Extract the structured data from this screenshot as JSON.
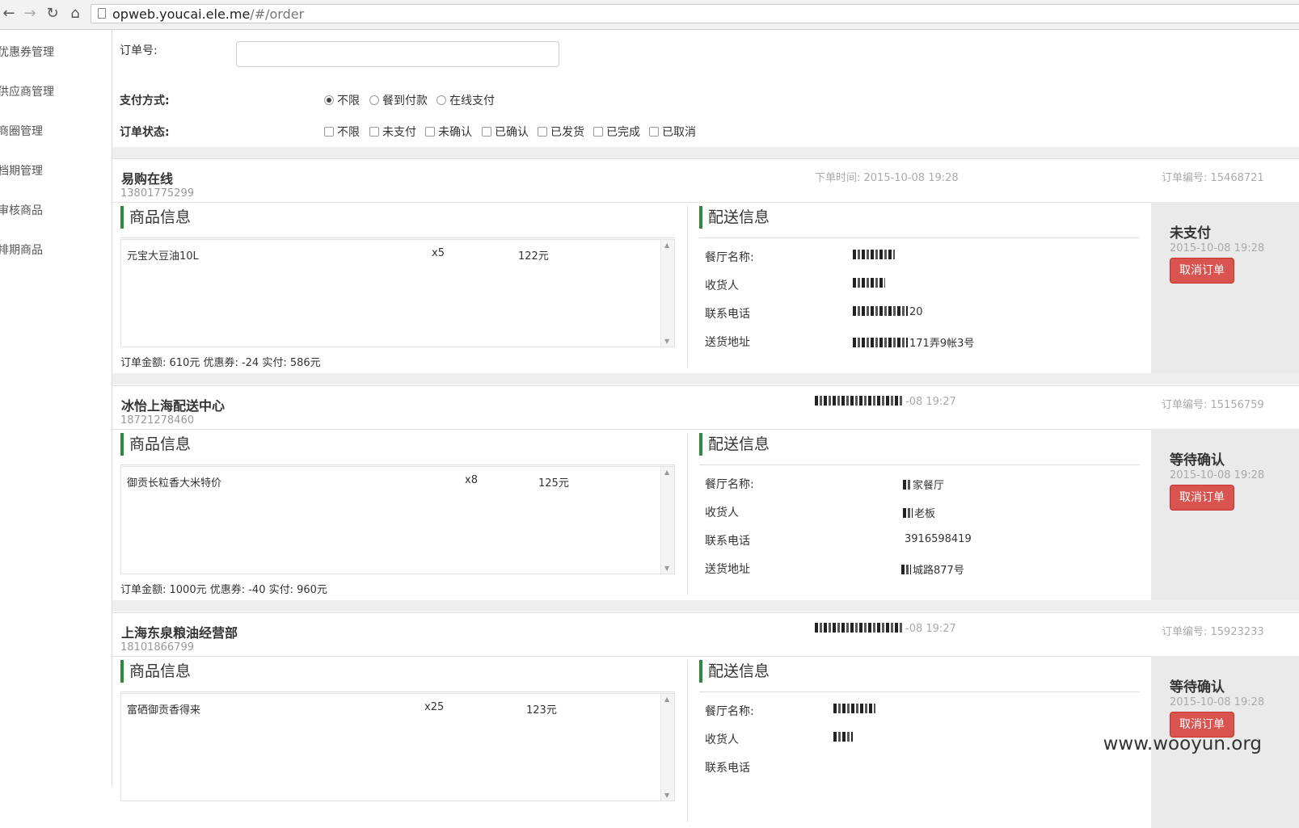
{
  "browser": {
    "url_host": "opweb.youcai.ele.me",
    "url_path": "/#/order"
  },
  "sidebar": {
    "items": [
      "优惠券管理",
      "供应商管理",
      "商圈管理",
      "档期管理",
      "审核商品",
      "排期商品"
    ]
  },
  "filters": {
    "order_no_label": "订单号:",
    "order_no_value": "",
    "payment_label": "支付方式:",
    "payment_options": [
      "不限",
      "餐到付款",
      "在线支付"
    ],
    "payment_selected": "不限",
    "status_label": "订单状态:",
    "status_options": [
      "不限",
      "未支付",
      "未确认",
      "已确认",
      "已发货",
      "已完成",
      "已取消"
    ]
  },
  "labels": {
    "goods_title": "商品信息",
    "delivery_title": "配送信息",
    "restaurant": "餐厅名称:",
    "receiver": "收货人",
    "contact": "联系电话",
    "address": "送货地址",
    "cancel": "取消订单"
  },
  "orders": [
    {
      "shop": "易购在线",
      "phone": "13801775299",
      "order_time": "下单时间: 2015-10-08 19:28",
      "order_no": "订单编号: 15468721",
      "item_name": "元宝大豆油10L",
      "item_qty": "x5",
      "item_price": "122元",
      "summary": "订单金额: 610元 优惠券: -24 实付: 586元",
      "restaurant_value": "",
      "receiver_value": "",
      "contact_value": "20",
      "address_value": "171弄9帐3号",
      "status": "未支付",
      "status_time": "2015-10-08 19:28"
    },
    {
      "shop": "冰怡上海配送中心",
      "phone": "18721278460",
      "order_time": "-08 19:27",
      "order_no": "订单编号: 15156759",
      "item_name": "御贡长粒香大米特价",
      "item_qty": "x8",
      "item_price": "125元",
      "summary": "订单金额: 1000元 优惠券: -40 实付: 960元",
      "restaurant_value": "家餐厅",
      "receiver_value": "老板",
      "contact_value": "3916598419",
      "address_value": "城路877号",
      "status": "等待确认",
      "status_time": "2015-10-08 19:28"
    },
    {
      "shop": "上海东泉粮油经营部",
      "phone": "18101866799",
      "order_time": "-08 19:27",
      "order_no": "订单编号: 15923233",
      "item_name": "富硒御贡香得来",
      "item_qty": "x25",
      "item_price": "123元",
      "summary": "",
      "restaurant_value": "",
      "receiver_value": "",
      "contact_value": "",
      "address_value": "",
      "status": "等待确认",
      "status_time": "2015-10-08 19:28"
    }
  ],
  "watermark": "www.wooyun.org",
  "colors": {
    "accent_green": "#2e8b3e",
    "danger_red": "#d9534f",
    "band_gray": "#eeeeee"
  }
}
